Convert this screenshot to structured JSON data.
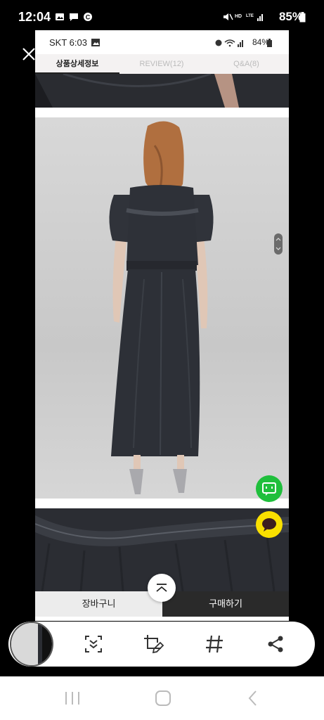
{
  "outer_status": {
    "time": "12:04",
    "battery": "85%"
  },
  "inner_status": {
    "carrier_time": "SKT 6:03",
    "battery": "84%"
  },
  "tabs": [
    {
      "label": "상품상세정보",
      "active": true
    },
    {
      "label": "REVIEW(12)",
      "active": false
    },
    {
      "label": "Q&A(8)",
      "active": false
    }
  ],
  "bottom_buttons": {
    "cart": "장바구니",
    "buy": "구매하기"
  },
  "icons": {
    "close": "close-icon",
    "scroll_top": "chevron-up-icon",
    "talk_green": "naver-talktalk-icon",
    "talk_yellow": "kakaotalk-icon",
    "scroll_capture": "scroll-capture-icon",
    "crop_edit": "crop-edit-icon",
    "tag": "hashtag-icon",
    "share": "share-icon"
  },
  "colors": {
    "buy_button": "#2a2a2a",
    "talk_green": "#1fbf3c",
    "kakao_yellow": "#f9e000"
  }
}
